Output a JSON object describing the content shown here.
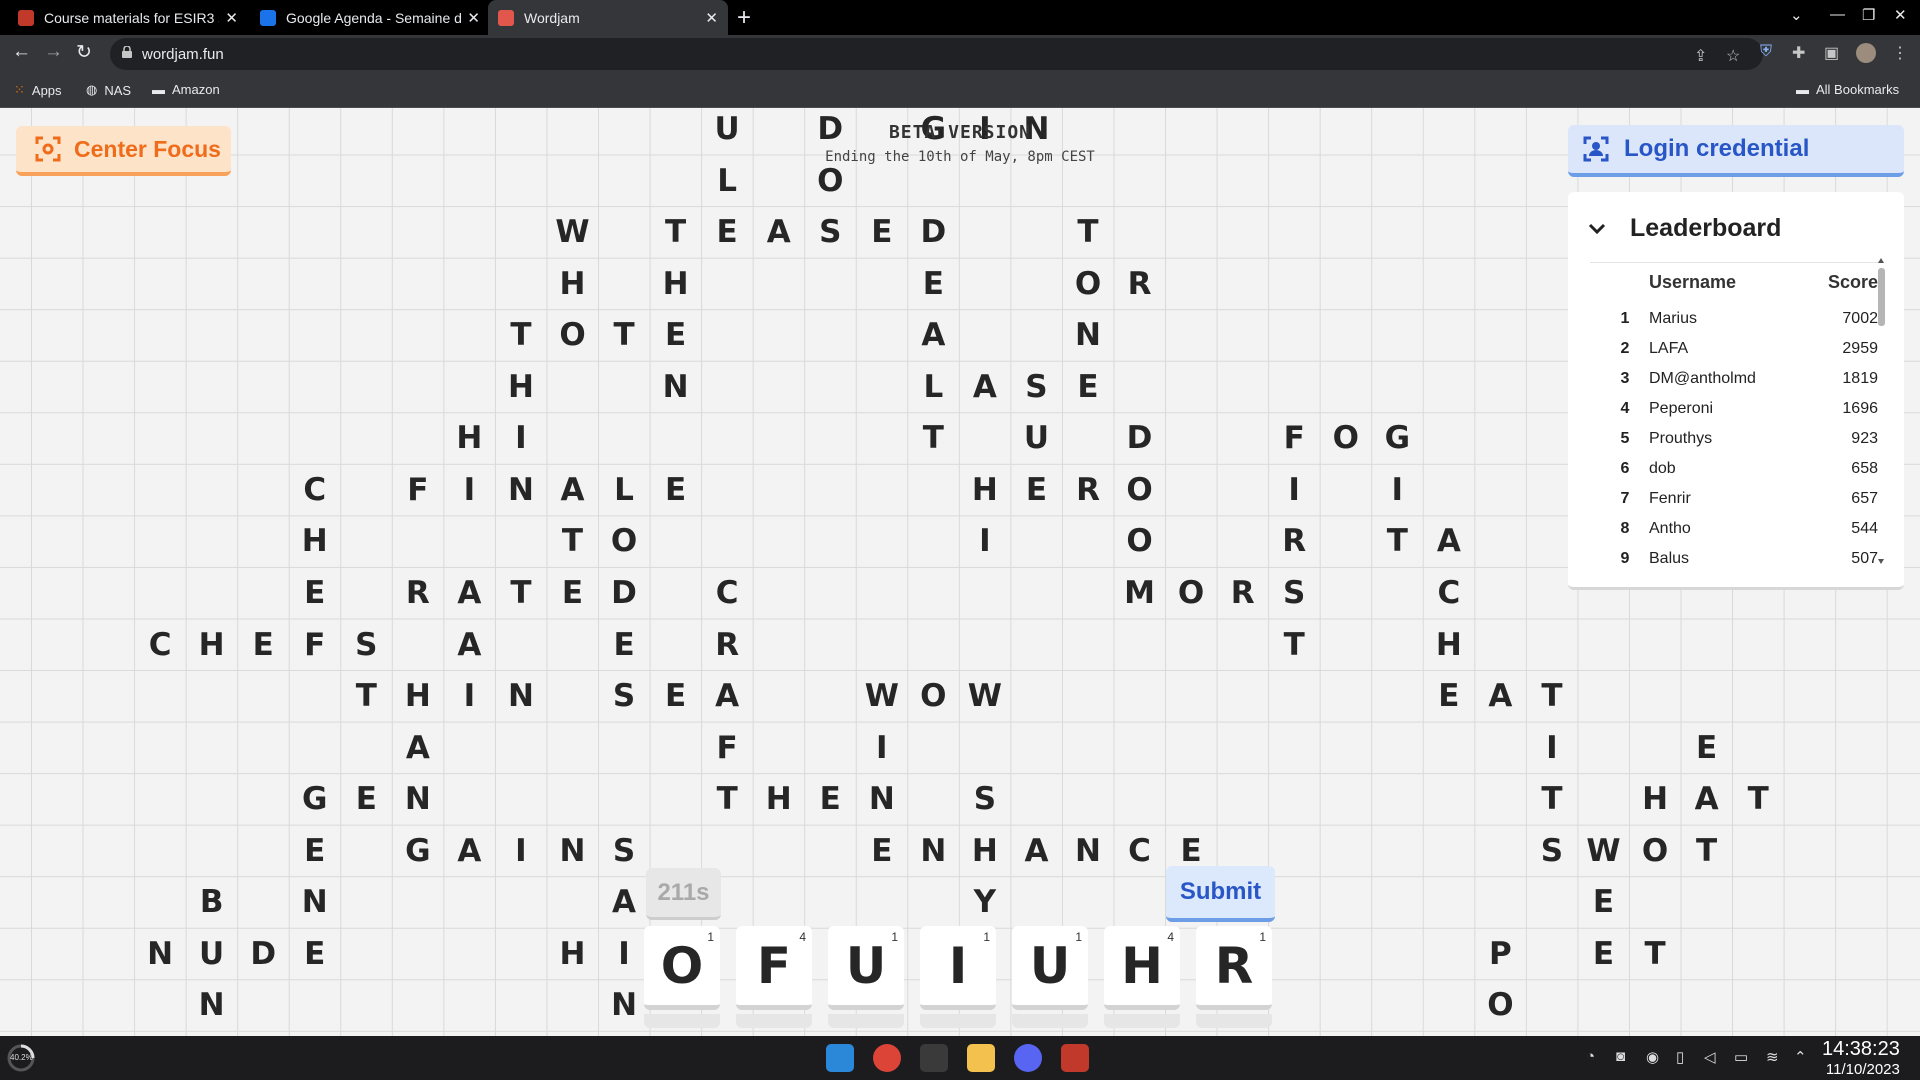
{
  "browser": {
    "tabs": [
      {
        "title": "Course materials for ESIR3 s",
        "active": false,
        "favicon_color": "#c0392b"
      },
      {
        "title": "Google Agenda - Semaine d",
        "active": false,
        "favicon_color": "#1a73e8"
      },
      {
        "title": "Wordjam",
        "active": true,
        "favicon_color": "#e2574c"
      }
    ],
    "url": "wordjam.fun",
    "bookmarks": [
      {
        "label": "Apps",
        "icon": "apps-grid-icon"
      },
      {
        "label": "NAS",
        "icon": "globe-icon"
      },
      {
        "label": "Amazon",
        "icon": "folder-icon"
      }
    ],
    "all_bookmarks": "All Bookmarks"
  },
  "game": {
    "center_focus": "Center Focus",
    "beta_title": "BETA VERSION",
    "beta_subtitle": "Ending the 10th of May, 8pm CEST",
    "login": "Login credential",
    "leaderboard": {
      "title": "Leaderboard",
      "col_username": "Username",
      "col_score": "Score",
      "rows": [
        {
          "rank": "1",
          "username": "Marius",
          "score": "7002"
        },
        {
          "rank": "2",
          "username": "LAFA",
          "score": "2959"
        },
        {
          "rank": "3",
          "username": "DM@antholmd",
          "score": "1819"
        },
        {
          "rank": "4",
          "username": "Peperoni",
          "score": "1696"
        },
        {
          "rank": "5",
          "username": "Prouthys",
          "score": "923"
        },
        {
          "rank": "6",
          "username": "dob",
          "score": "658"
        },
        {
          "rank": "7",
          "username": "Fenrir",
          "score": "657"
        },
        {
          "rank": "8",
          "username": "Antho",
          "score": "544"
        },
        {
          "rank": "9",
          "username": "Balus",
          "score": "507"
        }
      ]
    },
    "timer": "211s",
    "submit": "Submit",
    "rack": [
      {
        "letter": "O",
        "score": "1"
      },
      {
        "letter": "F",
        "score": "4"
      },
      {
        "letter": "U",
        "score": "1"
      },
      {
        "letter": "I",
        "score": "1"
      },
      {
        "letter": "U",
        "score": "1"
      },
      {
        "letter": "H",
        "score": "4"
      },
      {
        "letter": "R",
        "score": "1"
      }
    ],
    "board": [
      {
        "r": 0,
        "c": 13,
        "l": "U"
      },
      {
        "r": 0,
        "c": 15,
        "l": "D"
      },
      {
        "r": 0,
        "c": 17,
        "l": "G"
      },
      {
        "r": 0,
        "c": 18,
        "l": "I"
      },
      {
        "r": 0,
        "c": 19,
        "l": "N"
      },
      {
        "r": 1,
        "c": 13,
        "l": "L"
      },
      {
        "r": 1,
        "c": 15,
        "l": "O"
      },
      {
        "r": 2,
        "c": 10,
        "l": "W"
      },
      {
        "r": 2,
        "c": 12,
        "l": "T"
      },
      {
        "r": 2,
        "c": 13,
        "l": "E"
      },
      {
        "r": 2,
        "c": 14,
        "l": "A"
      },
      {
        "r": 2,
        "c": 15,
        "l": "S"
      },
      {
        "r": 2,
        "c": 16,
        "l": "E"
      },
      {
        "r": 2,
        "c": 17,
        "l": "D"
      },
      {
        "r": 2,
        "c": 20,
        "l": "T"
      },
      {
        "r": 3,
        "c": 10,
        "l": "H"
      },
      {
        "r": 3,
        "c": 12,
        "l": "H"
      },
      {
        "r": 3,
        "c": 17,
        "l": "E"
      },
      {
        "r": 3,
        "c": 20,
        "l": "O"
      },
      {
        "r": 3,
        "c": 21,
        "l": "R"
      },
      {
        "r": 4,
        "c": 9,
        "l": "T"
      },
      {
        "r": 4,
        "c": 10,
        "l": "O"
      },
      {
        "r": 4,
        "c": 11,
        "l": "T"
      },
      {
        "r": 4,
        "c": 12,
        "l": "E"
      },
      {
        "r": 4,
        "c": 17,
        "l": "A"
      },
      {
        "r": 4,
        "c": 20,
        "l": "N"
      },
      {
        "r": 5,
        "c": 9,
        "l": "H"
      },
      {
        "r": 5,
        "c": 12,
        "l": "N"
      },
      {
        "r": 5,
        "c": 17,
        "l": "L"
      },
      {
        "r": 5,
        "c": 18,
        "l": "A"
      },
      {
        "r": 5,
        "c": 19,
        "l": "S"
      },
      {
        "r": 5,
        "c": 20,
        "l": "E"
      },
      {
        "r": 6,
        "c": 8,
        "l": "H"
      },
      {
        "r": 6,
        "c": 9,
        "l": "I"
      },
      {
        "r": 6,
        "c": 17,
        "l": "T"
      },
      {
        "r": 6,
        "c": 19,
        "l": "U"
      },
      {
        "r": 6,
        "c": 21,
        "l": "D"
      },
      {
        "r": 6,
        "c": 24,
        "l": "F"
      },
      {
        "r": 6,
        "c": 25,
        "l": "O"
      },
      {
        "r": 6,
        "c": 26,
        "l": "G"
      },
      {
        "r": 7,
        "c": 5,
        "l": "C"
      },
      {
        "r": 7,
        "c": 7,
        "l": "F"
      },
      {
        "r": 7,
        "c": 8,
        "l": "I"
      },
      {
        "r": 7,
        "c": 9,
        "l": "N"
      },
      {
        "r": 7,
        "c": 10,
        "l": "A"
      },
      {
        "r": 7,
        "c": 11,
        "l": "L"
      },
      {
        "r": 7,
        "c": 12,
        "l": "E"
      },
      {
        "r": 7,
        "c": 18,
        "l": "H"
      },
      {
        "r": 7,
        "c": 19,
        "l": "E"
      },
      {
        "r": 7,
        "c": 20,
        "l": "R"
      },
      {
        "r": 7,
        "c": 21,
        "l": "O"
      },
      {
        "r": 7,
        "c": 24,
        "l": "I"
      },
      {
        "r": 7,
        "c": 26,
        "l": "I"
      },
      {
        "r": 8,
        "c": 5,
        "l": "H"
      },
      {
        "r": 8,
        "c": 10,
        "l": "T"
      },
      {
        "r": 8,
        "c": 11,
        "l": "O"
      },
      {
        "r": 8,
        "c": 18,
        "l": "I"
      },
      {
        "r": 8,
        "c": 21,
        "l": "O"
      },
      {
        "r": 8,
        "c": 24,
        "l": "R"
      },
      {
        "r": 8,
        "c": 26,
        "l": "T"
      },
      {
        "r": 8,
        "c": 27,
        "l": "A"
      },
      {
        "r": 9,
        "c": 5,
        "l": "E"
      },
      {
        "r": 9,
        "c": 7,
        "l": "R"
      },
      {
        "r": 9,
        "c": 8,
        "l": "A"
      },
      {
        "r": 9,
        "c": 9,
        "l": "T"
      },
      {
        "r": 9,
        "c": 10,
        "l": "E"
      },
      {
        "r": 9,
        "c": 11,
        "l": "D"
      },
      {
        "r": 9,
        "c": 13,
        "l": "C"
      },
      {
        "r": 9,
        "c": 21,
        "l": "M"
      },
      {
        "r": 9,
        "c": 22,
        "l": "O"
      },
      {
        "r": 9,
        "c": 23,
        "l": "R"
      },
      {
        "r": 9,
        "c": 24,
        "l": "S"
      },
      {
        "r": 9,
        "c": 27,
        "l": "C"
      },
      {
        "r": 10,
        "c": 2,
        "l": "C"
      },
      {
        "r": 10,
        "c": 3,
        "l": "H"
      },
      {
        "r": 10,
        "c": 4,
        "l": "E"
      },
      {
        "r": 10,
        "c": 5,
        "l": "F"
      },
      {
        "r": 10,
        "c": 6,
        "l": "S"
      },
      {
        "r": 10,
        "c": 8,
        "l": "A"
      },
      {
        "r": 10,
        "c": 11,
        "l": "E"
      },
      {
        "r": 10,
        "c": 13,
        "l": "R"
      },
      {
        "r": 10,
        "c": 24,
        "l": "T"
      },
      {
        "r": 10,
        "c": 27,
        "l": "H"
      },
      {
        "r": 11,
        "c": 6,
        "l": "T"
      },
      {
        "r": 11,
        "c": 7,
        "l": "H"
      },
      {
        "r": 11,
        "c": 8,
        "l": "I"
      },
      {
        "r": 11,
        "c": 9,
        "l": "N"
      },
      {
        "r": 11,
        "c": 11,
        "l": "S"
      },
      {
        "r": 11,
        "c": 12,
        "l": "E"
      },
      {
        "r": 11,
        "c": 13,
        "l": "A"
      },
      {
        "r": 11,
        "c": 16,
        "l": "W"
      },
      {
        "r": 11,
        "c": 17,
        "l": "O"
      },
      {
        "r": 11,
        "c": 18,
        "l": "W"
      },
      {
        "r": 11,
        "c": 27,
        "l": "E"
      },
      {
        "r": 11,
        "c": 28,
        "l": "A"
      },
      {
        "r": 11,
        "c": 29,
        "l": "T"
      },
      {
        "r": 12,
        "c": 7,
        "l": "A"
      },
      {
        "r": 12,
        "c": 13,
        "l": "F"
      },
      {
        "r": 12,
        "c": 16,
        "l": "I"
      },
      {
        "r": 12,
        "c": 29,
        "l": "I"
      },
      {
        "r": 12,
        "c": 32,
        "l": "E"
      },
      {
        "r": 13,
        "c": 5,
        "l": "G"
      },
      {
        "r": 13,
        "c": 6,
        "l": "E"
      },
      {
        "r": 13,
        "c": 7,
        "l": "N"
      },
      {
        "r": 13,
        "c": 13,
        "l": "T"
      },
      {
        "r": 13,
        "c": 14,
        "l": "H"
      },
      {
        "r": 13,
        "c": 15,
        "l": "E"
      },
      {
        "r": 13,
        "c": 16,
        "l": "N"
      },
      {
        "r": 13,
        "c": 18,
        "l": "S"
      },
      {
        "r": 13,
        "c": 29,
        "l": "T"
      },
      {
        "r": 13,
        "c": 31,
        "l": "H"
      },
      {
        "r": 13,
        "c": 32,
        "l": "A"
      },
      {
        "r": 13,
        "c": 33,
        "l": "T"
      },
      {
        "r": 14,
        "c": 5,
        "l": "E"
      },
      {
        "r": 14,
        "c": 7,
        "l": "G"
      },
      {
        "r": 14,
        "c": 8,
        "l": "A"
      },
      {
        "r": 14,
        "c": 9,
        "l": "I"
      },
      {
        "r": 14,
        "c": 10,
        "l": "N"
      },
      {
        "r": 14,
        "c": 11,
        "l": "S"
      },
      {
        "r": 14,
        "c": 16,
        "l": "E"
      },
      {
        "r": 14,
        "c": 17,
        "l": "N"
      },
      {
        "r": 14,
        "c": 18,
        "l": "H"
      },
      {
        "r": 14,
        "c": 19,
        "l": "A"
      },
      {
        "r": 14,
        "c": 20,
        "l": "N"
      },
      {
        "r": 14,
        "c": 21,
        "l": "C"
      },
      {
        "r": 14,
        "c": 22,
        "l": "E"
      },
      {
        "r": 14,
        "c": 29,
        "l": "S"
      },
      {
        "r": 14,
        "c": 30,
        "l": "W"
      },
      {
        "r": 14,
        "c": 31,
        "l": "O"
      },
      {
        "r": 14,
        "c": 32,
        "l": "T"
      },
      {
        "r": 15,
        "c": 3,
        "l": "B"
      },
      {
        "r": 15,
        "c": 5,
        "l": "N"
      },
      {
        "r": 15,
        "c": 11,
        "l": "A"
      },
      {
        "r": 15,
        "c": 18,
        "l": "Y"
      },
      {
        "r": 15,
        "c": 30,
        "l": "E"
      },
      {
        "r": 16,
        "c": 2,
        "l": "N"
      },
      {
        "r": 16,
        "c": 3,
        "l": "U"
      },
      {
        "r": 16,
        "c": 4,
        "l": "D"
      },
      {
        "r": 16,
        "c": 5,
        "l": "E"
      },
      {
        "r": 16,
        "c": 10,
        "l": "H"
      },
      {
        "r": 16,
        "c": 11,
        "l": "I"
      },
      {
        "r": 16,
        "c": 28,
        "l": "P"
      },
      {
        "r": 16,
        "c": 30,
        "l": "E"
      },
      {
        "r": 16,
        "c": 31,
        "l": "T"
      },
      {
        "r": 17,
        "c": 3,
        "l": "N"
      },
      {
        "r": 17,
        "c": 11,
        "l": "N"
      },
      {
        "r": 17,
        "c": 28,
        "l": "O"
      }
    ]
  },
  "taskbar": {
    "cpu": "40.2%",
    "time": "14:38:23",
    "date": "11/10/2023"
  }
}
